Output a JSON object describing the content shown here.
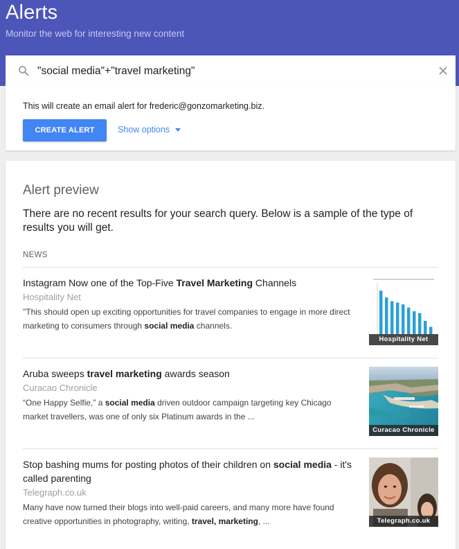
{
  "header": {
    "title": "Alerts",
    "subtitle": "Monitor the web for interesting new content"
  },
  "search": {
    "query": "\"social media\"+\"travel marketing\""
  },
  "create": {
    "info_text": "This will create an email alert for frederic@gonzomarketing.biz.",
    "create_button": "CREATE ALERT",
    "show_options": "Show options"
  },
  "preview": {
    "title": "Alert preview",
    "message": "There are no recent results for your search query. Below is a sample of the type of results you will get.",
    "section_label": "NEWS",
    "articles": [
      {
        "title_parts": [
          "Instagram Now one of the Top-Five ",
          "Travel Marketing",
          " Channels"
        ],
        "source": "Hospitality Net",
        "snippet_parts": [
          "\"This should open up exciting opportunities for travel companies to engage in more direct marketing to consumers through ",
          "social media",
          " channels."
        ],
        "thumb_caption": "Hospitality Net",
        "bar_values": [
          9.5,
          8.0,
          7.2,
          6.9,
          6.5,
          5.8,
          5.0,
          4.6,
          2.9,
          1.6
        ]
      },
      {
        "title_parts": [
          "Aruba sweeps ",
          "travel marketing",
          " awards season"
        ],
        "source": "Curacao Chronicle",
        "snippet_parts": [
          "“One Happy Selfie,” a ",
          "social media",
          " driven outdoor campaign targeting key Chicago market travellers, was one of only six Platinum awards in the ..."
        ],
        "thumb_caption": "Curacao Chronicle"
      },
      {
        "title_parts": [
          "Stop bashing mums for posting photos of their children on ",
          "social media",
          " - it's called parenting"
        ],
        "source": "Telegraph.co.uk",
        "snippet_parts": [
          "Many have now turned their blogs into well-paid careers, and many more have found creative opportunities in photography, writing, ",
          "travel, marketing",
          ", ..."
        ],
        "thumb_caption": "Telegraph.co.uk"
      }
    ]
  },
  "colors": {
    "header_bg": "#4c55b8",
    "button_bg": "#4285f4",
    "link": "#4285f4"
  }
}
